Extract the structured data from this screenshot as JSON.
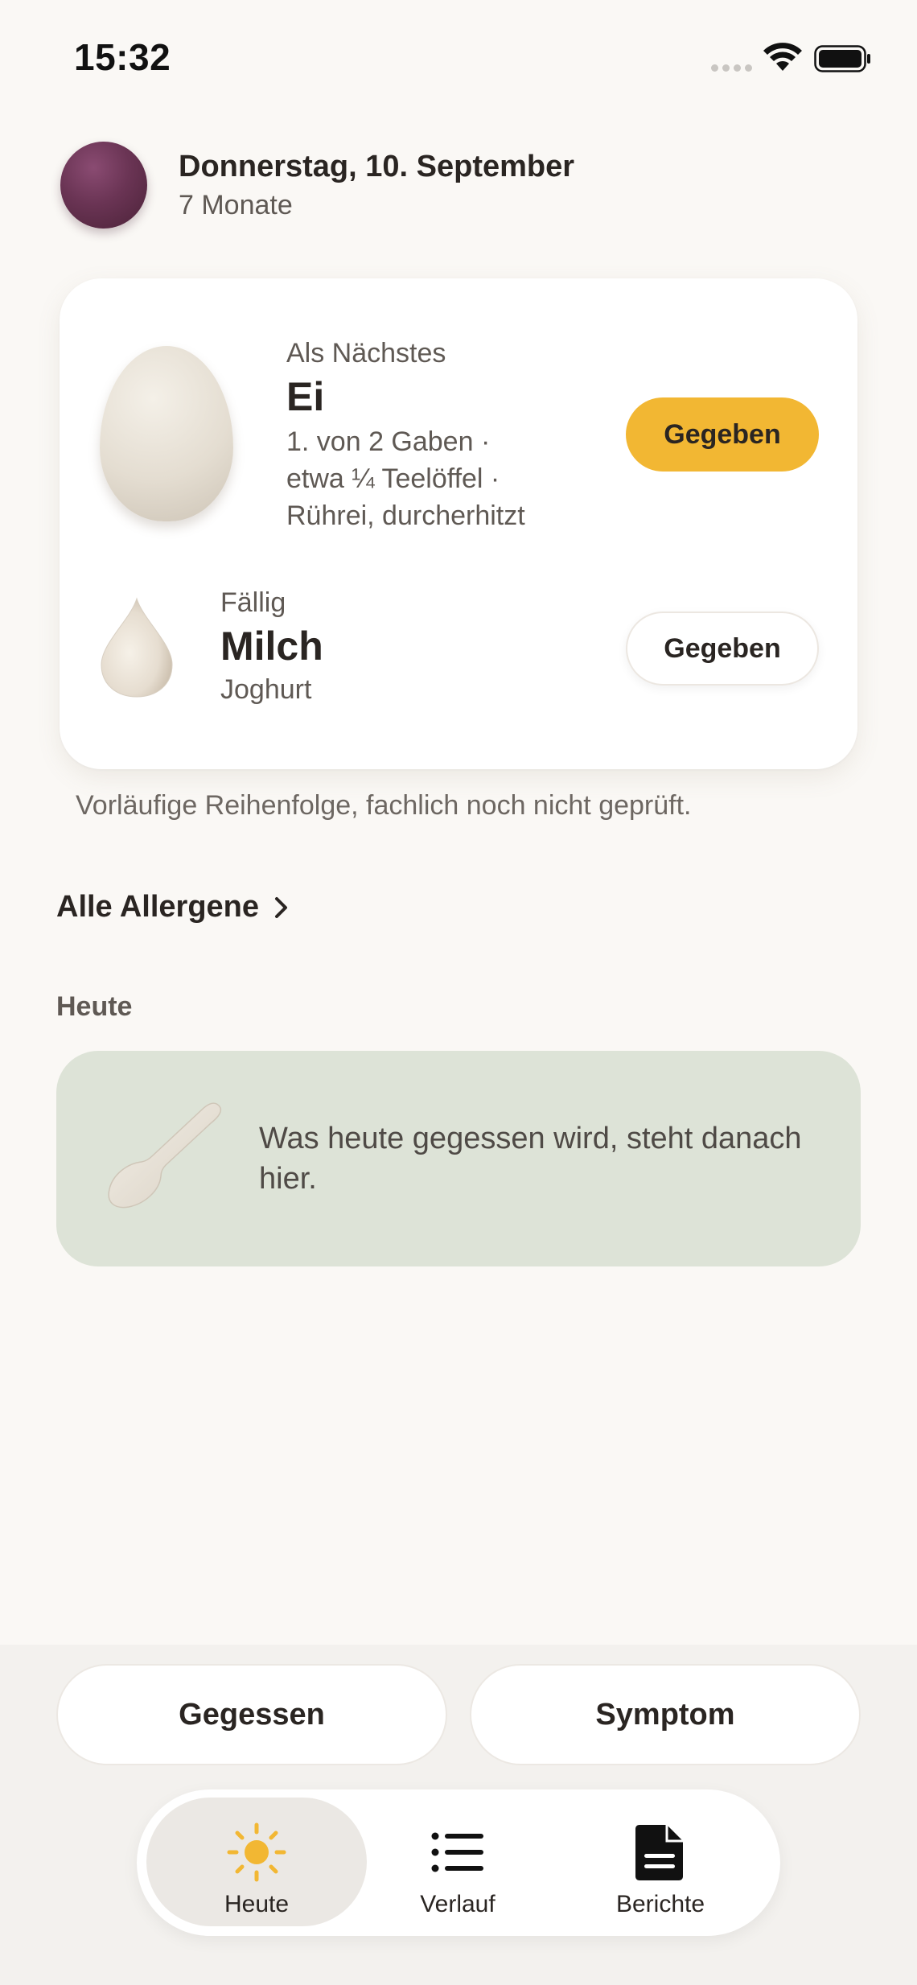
{
  "status_bar": {
    "time": "15:32"
  },
  "header": {
    "date": "Donnerstag, 10. September",
    "age": "7 Monate"
  },
  "next_card": {
    "item1": {
      "label": "Als Nächstes",
      "name": "Ei",
      "detail_line1": "1. von 2 Gaben ·",
      "detail_line2": "etwa ¼ Teelöffel ·",
      "detail_line3": "Rührei, durcherhitzt",
      "button": "Gegeben"
    },
    "item2": {
      "label": "Fällig",
      "name": "Milch",
      "detail": "Joghurt",
      "button": "Gegeben"
    }
  },
  "disclaimer": "Vorläufige Reihenfolge, fachlich noch nicht geprüft.",
  "all_allergens": "Alle Allergene",
  "today": {
    "heading": "Heute",
    "empty_text": "Was heute gegessen wird, steht danach hier."
  },
  "actions": {
    "eaten": "Gegessen",
    "symptom": "Symptom"
  },
  "tabs": [
    {
      "label": "Heute",
      "icon": "sun-icon",
      "active": true
    },
    {
      "label": "Verlauf",
      "icon": "list-icon",
      "active": false
    },
    {
      "label": "Berichte",
      "icon": "document-icon",
      "active": false
    }
  ],
  "colors": {
    "accent": "#f2b733",
    "background": "#faf8f5",
    "today_card": "#dde3d7"
  }
}
